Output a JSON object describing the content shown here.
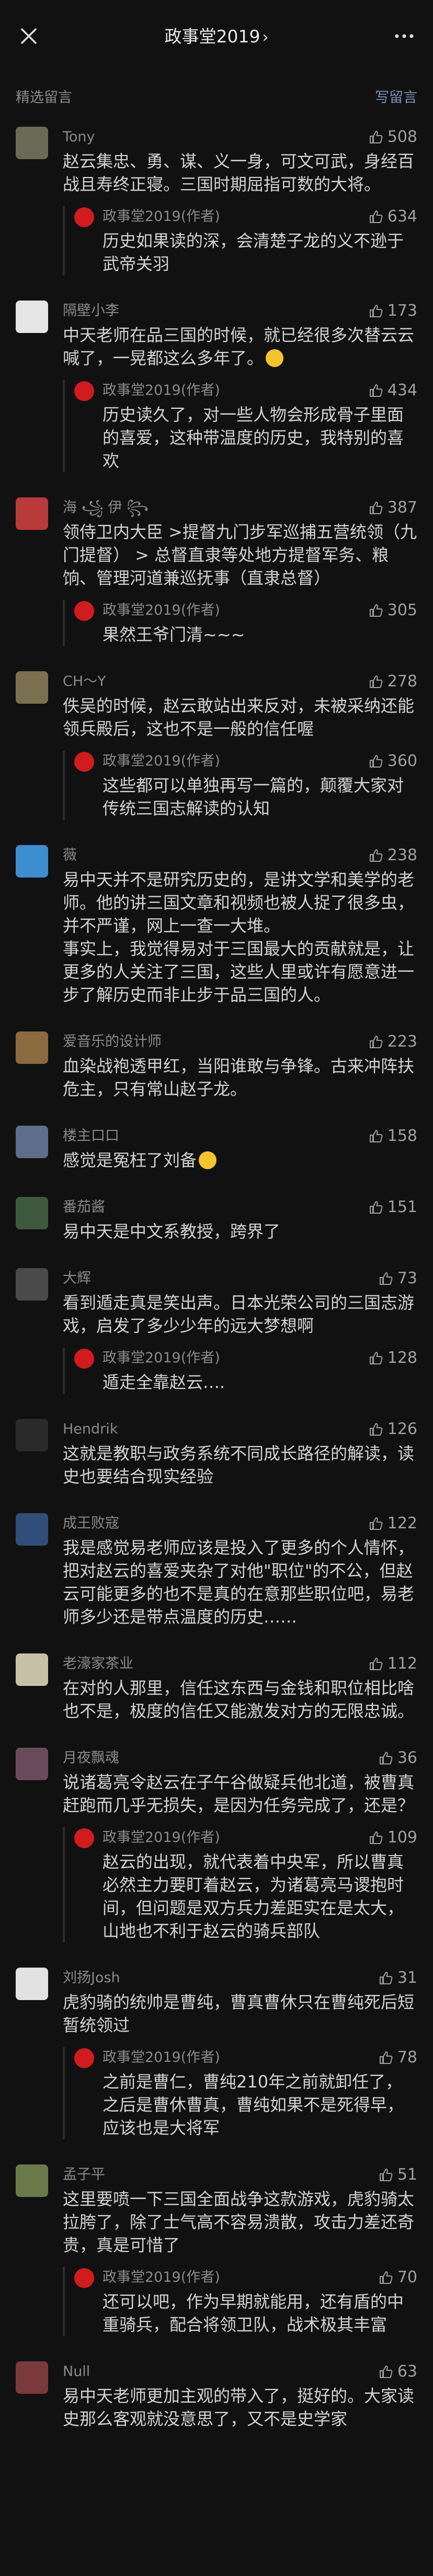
{
  "nav": {
    "title": "政事堂2019",
    "chevron": "›"
  },
  "section": {
    "title": "精选留言",
    "write": "写留言"
  },
  "comments": [
    {
      "nick": "Tony",
      "likes": "508",
      "avatar_color": "#6b6a55",
      "text": "赵云集忠、勇、谋、义一身，可文可武，身经百战且寿终正寝。三国时期屈指可数的大将。",
      "reply": {
        "author": "政事堂2019(作者)",
        "likes": "634",
        "text": "历史如果读的深，会清楚子龙的义不逊于武帝关羽"
      }
    },
    {
      "nick": "隔壁小李",
      "likes": "173",
      "avatar_color": "#e6e6e6",
      "text": "中天老师在品三国的时候，就已经很多次替云云喊了，一晃都这么多年了。",
      "emoji": true,
      "reply": {
        "author": "政事堂2019(作者)",
        "likes": "434",
        "text": "历史读久了，对一些人物会形成骨子里面的喜爱，这种带温度的历史，我特别的喜欢"
      }
    },
    {
      "nick": "海 ꧁ 伊 ꧂",
      "likes": "387",
      "avatar_color": "#b83a3a",
      "text": "领侍卫内大臣 >提督九门步军巡捕五营统领（九门提督） > 总督直隶等处地方提督军务、粮饷、管理河道兼巡抚事（直隶总督）",
      "reply": {
        "author": "政事堂2019(作者)",
        "likes": "305",
        "text": "果然王爷门清~~~"
      }
    },
    {
      "nick": "CH～Y",
      "likes": "278",
      "avatar_color": "#7a7050",
      "text": "佚吴的时候，赵云敢站出来反对，未被采纳还能领兵殿后，这也不是一般的信任喔",
      "reply": {
        "author": "政事堂2019(作者)",
        "likes": "360",
        "text": "这些都可以单独再写一篇的，颠覆大家对传统三国志解读的认知"
      }
    },
    {
      "nick": "薇",
      "likes": "238",
      "avatar_color": "#3c8ed0",
      "text": "易中天并不是研究历史的，是讲文学和美学的老师。他的讲三国文章和视频也被人捉了很多虫，并不严谨，网上一查一大堆。\n事实上，我觉得易对于三国最大的贡献就是，让更多的人关注了三国，这些人里或许有愿意进一步了解历史而非止步于品三国的人。"
    },
    {
      "nick": "爱音乐的设计师",
      "likes": "223",
      "avatar_color": "#8a6a3e",
      "text": "血染战袍透甲红，当阳谁敢与争锋。古来冲阵扶危主，只有常山赵子龙。"
    },
    {
      "nick": "楼主口口",
      "likes": "158",
      "avatar_color": "#5c6e8a",
      "text": "感觉是冤枉了刘备",
      "emoji": true
    },
    {
      "nick": "番茄酱",
      "likes": "151",
      "avatar_color": "#3e5a3e",
      "text": "易中天是中文系教授，跨界了"
    },
    {
      "nick": "大辉",
      "likes": "73",
      "avatar_color": "#4a4a4a",
      "text": "看到遁走真是笑出声。日本光荣公司的三国志游戏，启发了多少少年的远大梦想啊",
      "reply": {
        "author": "政事堂2019(作者)",
        "likes": "128",
        "text": "遁走全靠赵云…."
      }
    },
    {
      "nick": "Hendrik",
      "likes": "126",
      "avatar_color": "#2a2a2a",
      "text": "这就是教职与政务系统不同成长路径的解读，读史也要结合现实经验"
    },
    {
      "nick": "成王败寇",
      "likes": "122",
      "avatar_color": "#2f4f7a",
      "text": "我是感觉易老师应该是投入了更多的个人情怀，把对赵云的喜爱夹杂了对他\"职位\"的不公，但赵云可能更多的也不是真的在意那些职位吧，易老师多少还是带点温度的历史……"
    },
    {
      "nick": "老濠家茶业",
      "likes": "112",
      "avatar_color": "#c9c0a8",
      "text": "在对的人那里，信任这东西与金钱和职位相比啥也不是，极度的信任又能激发对方的无限忠诚。"
    },
    {
      "nick": "月夜飘魂",
      "likes": "36",
      "avatar_color": "#6a4a5a",
      "text": "说诸葛亮令赵云在子午谷做疑兵他北道，被曹真赶跑而几乎无损失，是因为任务完成了，还是？",
      "reply": {
        "author": "政事堂2019(作者)",
        "likes": "109",
        "text": "赵云的出现，就代表着中央军，所以曹真必然主力要盯着赵云，为诸葛亮马谡抱时间，但问题是双方兵力差距实在是太大，山地也不利于赵云的骑兵部队"
      }
    },
    {
      "nick": "刘扬Josh",
      "likes": "31",
      "avatar_color": "#e2e2e2",
      "text": "虎豹骑的统帅是曹纯，曹真曹休只在曹纯死后短暂统领过",
      "reply": {
        "author": "政事堂2019(作者)",
        "likes": "78",
        "text": "之前是曹仁，曹纯210年之前就卸任了，之后是曹休曹真，曹纯如果不是死得早，应该也是大将军"
      }
    },
    {
      "nick": "孟子平",
      "likes": "51",
      "avatar_color": "#6a7a4a",
      "text": "这里要喷一下三国全面战争这款游戏，虎豹骑太拉胯了，除了士气高不容易溃散，攻击力差还奇贵，真是可惜了",
      "reply": {
        "author": "政事堂2019(作者)",
        "likes": "70",
        "text": "还可以吧，作为早期就能用，还有盾的中重骑兵，配合将领卫队，战术极其丰富"
      }
    },
    {
      "nick": "Null",
      "likes": "63",
      "avatar_color": "#7a3a3a",
      "text": "易中天老师更加主观的带入了，挺好的。大家读史那么客观就没意思了，又不是史学家"
    }
  ]
}
